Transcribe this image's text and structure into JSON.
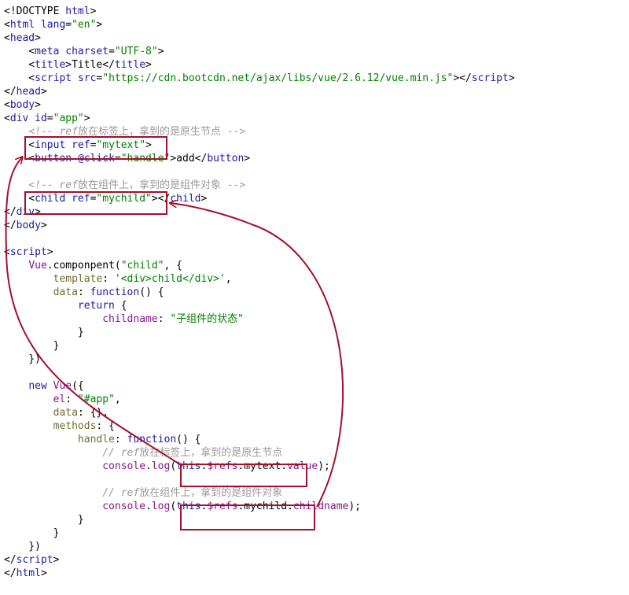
{
  "code_lines": [
    [
      [
        "t",
        "<!DOCTYPE "
      ],
      [
        "k",
        "html"
      ],
      [
        "t",
        ">"
      ]
    ],
    [
      [
        "t",
        "<"
      ],
      [
        "k",
        "html"
      ],
      [
        "t",
        " "
      ],
      [
        "a",
        "lang"
      ],
      [
        "t",
        "="
      ],
      [
        "s",
        "\"en\""
      ],
      [
        "t",
        ">"
      ]
    ],
    [
      [
        "t",
        "<"
      ],
      [
        "k",
        "head"
      ],
      [
        "t",
        ">"
      ]
    ],
    [
      [
        "t",
        "    <"
      ],
      [
        "k",
        "meta"
      ],
      [
        "t",
        " "
      ],
      [
        "a",
        "charset"
      ],
      [
        "t",
        "="
      ],
      [
        "s",
        "\"UTF-8\""
      ],
      [
        "t",
        ">"
      ]
    ],
    [
      [
        "t",
        "    <"
      ],
      [
        "k",
        "title"
      ],
      [
        "t",
        ">Title</"
      ],
      [
        "k",
        "title"
      ],
      [
        "t",
        ">"
      ]
    ],
    [
      [
        "t",
        "    <"
      ],
      [
        "k",
        "script"
      ],
      [
        "t",
        " "
      ],
      [
        "a",
        "src"
      ],
      [
        "t",
        "="
      ],
      [
        "s",
        "\"https://cdn.bootcdn.net/ajax/libs/vue/2.6.12/vue.min.js\""
      ],
      [
        "t",
        "></"
      ],
      [
        "k",
        "script"
      ],
      [
        "t",
        ">"
      ]
    ],
    [
      [
        "t",
        "</"
      ],
      [
        "k",
        "head"
      ],
      [
        "t",
        ">"
      ]
    ],
    [
      [
        "t",
        "<"
      ],
      [
        "k",
        "body"
      ],
      [
        "t",
        ">"
      ]
    ],
    [
      [
        "t",
        "<"
      ],
      [
        "k",
        "div"
      ],
      [
        "t",
        " "
      ],
      [
        "a",
        "id"
      ],
      [
        "t",
        "="
      ],
      [
        "s",
        "\"app\""
      ],
      [
        "t",
        ">"
      ]
    ],
    [
      [
        "t",
        "    "
      ],
      [
        "cr",
        "<!-- ref"
      ],
      [
        "c",
        "放在标签上，拿到的是原生节点 -->"
      ]
    ],
    [
      [
        "t",
        "    <"
      ],
      [
        "k",
        "input"
      ],
      [
        "t",
        " "
      ],
      [
        "a",
        "ref"
      ],
      [
        "t",
        "="
      ],
      [
        "s",
        "\"mytext\""
      ],
      [
        "t",
        ">"
      ]
    ],
    [
      [
        "t",
        "    <"
      ],
      [
        "k",
        "button"
      ],
      [
        "t",
        " "
      ],
      [
        "a",
        "@click"
      ],
      [
        "t",
        "="
      ],
      [
        "s",
        "\"handle\""
      ],
      [
        "t",
        ">add</"
      ],
      [
        "k",
        "button"
      ],
      [
        "t",
        ">"
      ]
    ],
    [
      [
        "t",
        ""
      ]
    ],
    [
      [
        "t",
        "    "
      ],
      [
        "cr",
        "<!-- ref"
      ],
      [
        "c",
        "放在组件上，拿到的是组件对象 -->"
      ]
    ],
    [
      [
        "t",
        "    <"
      ],
      [
        "k",
        "child"
      ],
      [
        "t",
        " "
      ],
      [
        "a",
        "ref"
      ],
      [
        "t",
        "="
      ],
      [
        "s",
        "\"mychild\""
      ],
      [
        "t",
        "></"
      ],
      [
        "k",
        "child"
      ],
      [
        "t",
        ">"
      ]
    ],
    [
      [
        "t",
        "</"
      ],
      [
        "k",
        "div"
      ],
      [
        "t",
        ">"
      ]
    ],
    [
      [
        "t",
        "</"
      ],
      [
        "k",
        "body"
      ],
      [
        "t",
        ">"
      ]
    ],
    [
      [
        "t",
        ""
      ]
    ],
    [
      [
        "t",
        "<"
      ],
      [
        "k",
        "script"
      ],
      [
        "t",
        ">"
      ]
    ],
    [
      [
        "t",
        "    "
      ],
      [
        "p",
        "Vue"
      ],
      [
        "t",
        ".componpent("
      ],
      [
        "s",
        "\"child\""
      ],
      [
        "t",
        ", {"
      ]
    ],
    [
      [
        "t",
        "        "
      ],
      [
        "pv",
        "template"
      ],
      [
        "t",
        ": "
      ],
      [
        "s",
        "'<div>child</div>'"
      ],
      [
        "t",
        ","
      ]
    ],
    [
      [
        "t",
        "        "
      ],
      [
        "pv",
        "data"
      ],
      [
        "t",
        ": "
      ],
      [
        "fn",
        "function"
      ],
      [
        "t",
        "() {"
      ]
    ],
    [
      [
        "t",
        "            "
      ],
      [
        "k",
        "return"
      ],
      [
        "t",
        " {"
      ]
    ],
    [
      [
        "t",
        "                "
      ],
      [
        "p",
        "childname"
      ],
      [
        "t",
        ": "
      ],
      [
        "s",
        "\"子组件的状态\""
      ]
    ],
    [
      [
        "t",
        "            }"
      ]
    ],
    [
      [
        "t",
        "        }"
      ]
    ],
    [
      [
        "t",
        "    })"
      ]
    ],
    [
      [
        "t",
        ""
      ]
    ],
    [
      [
        "t",
        "    "
      ],
      [
        "k",
        "new"
      ],
      [
        "t",
        " "
      ],
      [
        "p",
        "Vue"
      ],
      [
        "t",
        "({"
      ]
    ],
    [
      [
        "t",
        "        "
      ],
      [
        "p",
        "el"
      ],
      [
        "t",
        ": "
      ],
      [
        "s",
        "\"#app\""
      ],
      [
        "t",
        ","
      ]
    ],
    [
      [
        "t",
        "        "
      ],
      [
        "pv",
        "data"
      ],
      [
        "t",
        ": {},"
      ]
    ],
    [
      [
        "t",
        "        "
      ],
      [
        "pv",
        "methods"
      ],
      [
        "t",
        ": {"
      ]
    ],
    [
      [
        "t",
        "            "
      ],
      [
        "pv",
        "handle"
      ],
      [
        "t",
        ": "
      ],
      [
        "fn",
        "function"
      ],
      [
        "t",
        "() {"
      ]
    ],
    [
      [
        "t",
        "                "
      ],
      [
        "cr",
        "// ref"
      ],
      [
        "c",
        "放在标签上，拿到的是原生节点"
      ]
    ],
    [
      [
        "t",
        "                "
      ],
      [
        "p",
        "console"
      ],
      [
        "t",
        "."
      ],
      [
        "p",
        "log"
      ],
      [
        "t",
        "("
      ],
      [
        "k",
        "this"
      ],
      [
        "t",
        "."
      ],
      [
        "p",
        "$refs"
      ],
      [
        "t",
        ".mytext."
      ],
      [
        "p",
        "value"
      ],
      [
        "t",
        ");"
      ]
    ],
    [
      [
        "t",
        ""
      ]
    ],
    [
      [
        "t",
        "                "
      ],
      [
        "cr",
        "// ref"
      ],
      [
        "c",
        "放在组件上，拿到的是组件对象"
      ]
    ],
    [
      [
        "t",
        "                "
      ],
      [
        "p",
        "console"
      ],
      [
        "t",
        "."
      ],
      [
        "p",
        "log"
      ],
      [
        "t",
        "("
      ],
      [
        "k",
        "this"
      ],
      [
        "t",
        "."
      ],
      [
        "p",
        "$refs"
      ],
      [
        "t",
        ".mychild."
      ],
      [
        "p",
        "childname"
      ],
      [
        "t",
        ");"
      ]
    ],
    [
      [
        "t",
        "            }"
      ]
    ],
    [
      [
        "t",
        "        }"
      ]
    ],
    [
      [
        "t",
        "    })"
      ]
    ],
    [
      [
        "t",
        "</"
      ],
      [
        "k",
        "script"
      ],
      [
        "t",
        ">"
      ]
    ],
    [
      [
        "t",
        "</"
      ],
      [
        "k",
        "html"
      ],
      [
        "t",
        ">"
      ]
    ]
  ],
  "colors": {
    "annotation": "#a3102a",
    "tag": "#1a1aa6",
    "string": "#008000",
    "property": "#881391",
    "comment": "#9a9a9a"
  }
}
